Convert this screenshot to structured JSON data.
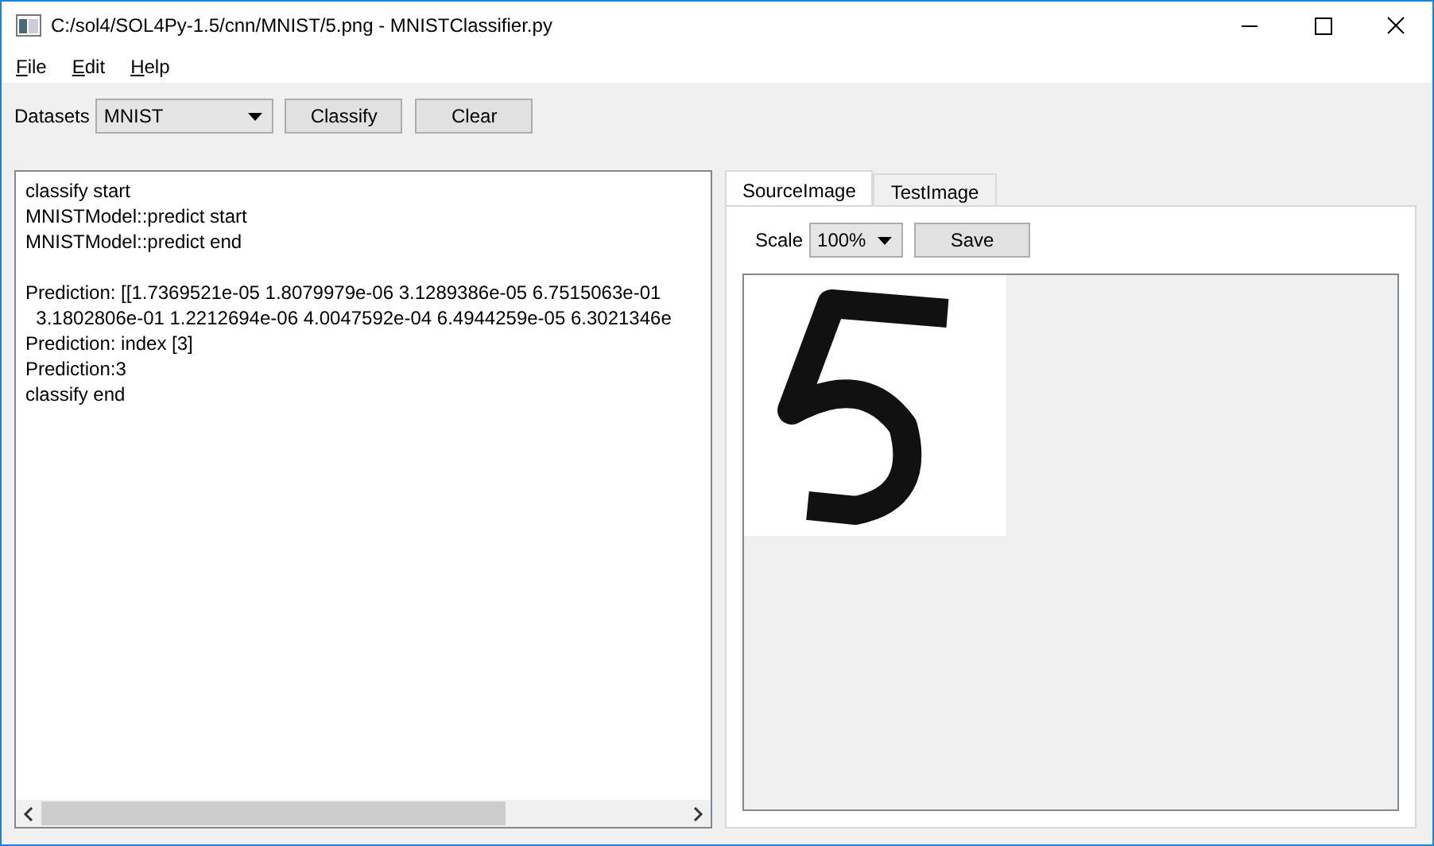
{
  "window": {
    "title": "C:/sol4/SOL4Py-1.5/cnn/MNIST/5.png - MNISTClassifier.py"
  },
  "menu": [
    "File",
    "Edit",
    "Help"
  ],
  "toolbar": {
    "label": "Datasets",
    "dataset": "MNIST",
    "buttons": [
      "Classify",
      "Clear"
    ]
  },
  "log": [
    {
      "kind": "text",
      "text": "classify start"
    },
    {
      "kind": "text",
      "text": "MNISTModel::predict start"
    },
    {
      "kind": "text",
      "text": "MNISTModel::predict end"
    },
    {
      "kind": "blank"
    },
    {
      "kind": "text",
      "text": "Prediction: [[1.7369521e-05 1.8079979e-06 3.1289386e-05 6.7515063e-01"
    },
    {
      "kind": "text",
      "text": "  3.1802806e-01 1.2212694e-06 4.0047592e-04 6.4944259e-05 6.3021346e"
    },
    {
      "kind": "text",
      "text": "Prediction: index [3]"
    },
    {
      "kind": "text",
      "text": "Prediction:3"
    },
    {
      "kind": "text",
      "text": "classify end"
    }
  ],
  "tabs": [
    {
      "label": "SourceImage",
      "selected": true
    },
    {
      "label": "TestImage",
      "selected": false
    }
  ],
  "image_panel": {
    "scale_label": "Scale",
    "scale": "100%",
    "save_button": "Save"
  }
}
